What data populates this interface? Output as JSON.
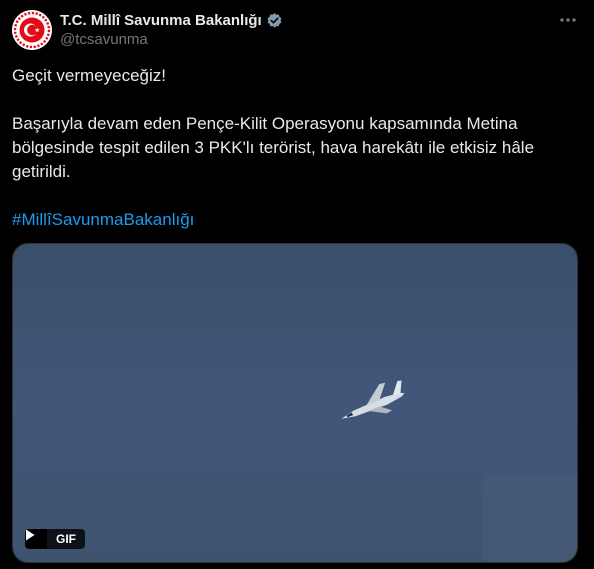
{
  "account": {
    "display_name": "T.C. Millî Savunma Bakanlığı",
    "handle": "@tcsavunma",
    "verified_icon": "verified-badge-icon",
    "avatar_icon": "ministry-emblem-icon"
  },
  "tweet": {
    "headline": "Geçit vermeyeceğiz!",
    "body": "Başarıyla devam eden Pençe-Kilit Operasyonu kapsamında Metina bölgesinde tespit edilen 3 PKK'lı terörist, hava harekâtı ile etkisiz hâle getirildi.",
    "hashtag": "#MillîSavunmaBakanlığı"
  },
  "media": {
    "type_label": "GIF",
    "play_icon": "play-icon",
    "description_icon": "fighter-jet-in-sky"
  },
  "menu": {
    "icon": "more-dots-icon"
  },
  "colors": {
    "background": "#000000",
    "text": "#e7e9ea",
    "secondary": "#71767b",
    "link": "#1d9bf0",
    "verified": "#829aab",
    "emblem_red": "#e30a17",
    "sky": "#3f5570"
  }
}
